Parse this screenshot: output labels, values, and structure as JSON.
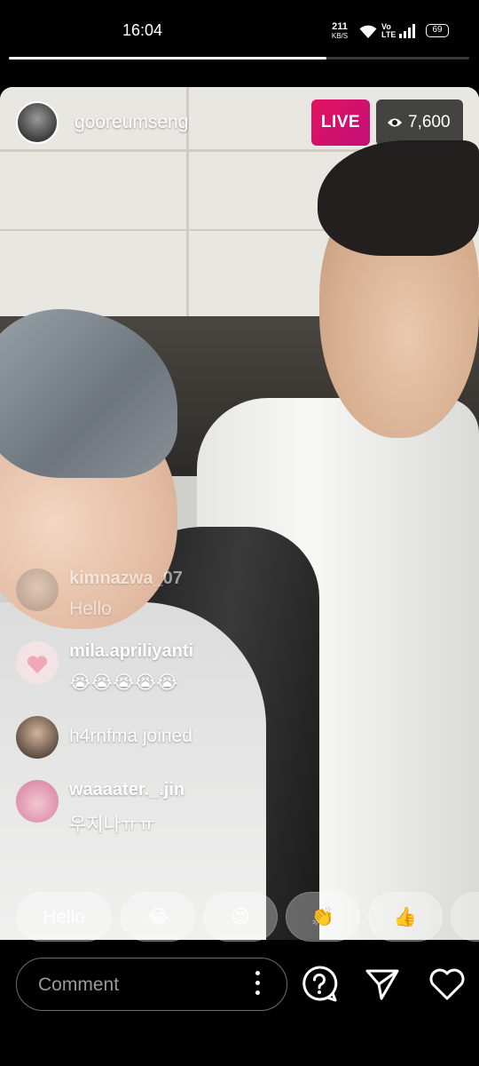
{
  "status_bar": {
    "time": "16:04",
    "net_speed_value": "211",
    "net_speed_unit": "KB/S",
    "volte_line1": "Vo",
    "volte_line2": "LTE",
    "battery": "69",
    "video_progress_fraction": 0.69
  },
  "live_header": {
    "username": "gooreumseng",
    "live_label": "LIVE",
    "viewer_count": "7,600"
  },
  "comments": [
    {
      "user": "kimnazwa_07",
      "text": "Hello",
      "faded": true
    },
    {
      "user": "mila.apriliyanti",
      "text": "😭😭😭😭😭",
      "faded": false
    },
    {
      "user": "h4rnfma",
      "joined_text": "h4rnfma joined"
    },
    {
      "user": "waaaater._.jin",
      "text": "우지나ㅠㅠ",
      "faded": false
    }
  ],
  "quick_reactions": [
    "Hello",
    "😂",
    "😍",
    "👏",
    "👍",
    "👍"
  ],
  "bottom_bar": {
    "comment_placeholder": "Comment",
    "icons": [
      "more-vertical-icon",
      "question-icon",
      "send-icon",
      "heart-icon"
    ]
  },
  "colors": {
    "live_badge": "#d4136b",
    "viewer_badge_bg": "#1e1e1e",
    "background": "#000000"
  }
}
